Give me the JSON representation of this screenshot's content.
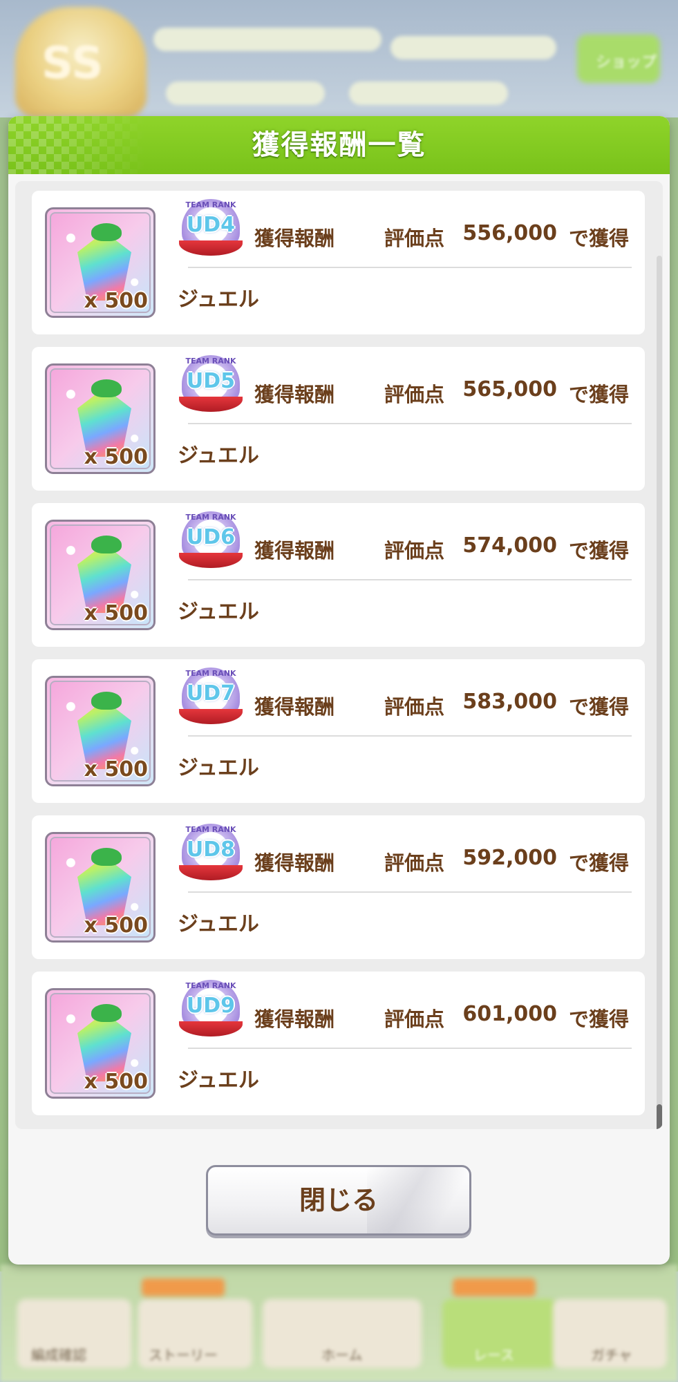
{
  "background": {
    "rank_emblem_text": "SS",
    "top_button_label": "ショップ",
    "nav": [
      "編成確認",
      "ストーリー",
      "ホーム",
      "レース",
      "ガチャ"
    ]
  },
  "dialog": {
    "title": "獲得報酬一覧",
    "close_label": "閉じる"
  },
  "rewards": [
    {
      "rank_team": "TEAM RANK",
      "rank": "UD4",
      "reward_label": "獲得報酬",
      "score_label": "評価点",
      "score": "556,000",
      "suffix": "で獲得",
      "quantity": "x 500",
      "item": "ジュエル"
    },
    {
      "rank_team": "TEAM RANK",
      "rank": "UD5",
      "reward_label": "獲得報酬",
      "score_label": "評価点",
      "score": "565,000",
      "suffix": "で獲得",
      "quantity": "x 500",
      "item": "ジュエル"
    },
    {
      "rank_team": "TEAM RANK",
      "rank": "UD6",
      "reward_label": "獲得報酬",
      "score_label": "評価点",
      "score": "574,000",
      "suffix": "で獲得",
      "quantity": "x 500",
      "item": "ジュエル"
    },
    {
      "rank_team": "TEAM RANK",
      "rank": "UD7",
      "reward_label": "獲得報酬",
      "score_label": "評価点",
      "score": "583,000",
      "suffix": "で獲得",
      "quantity": "x 500",
      "item": "ジュエル"
    },
    {
      "rank_team": "TEAM RANK",
      "rank": "UD8",
      "reward_label": "獲得報酬",
      "score_label": "評価点",
      "score": "592,000",
      "suffix": "で獲得",
      "quantity": "x 500",
      "item": "ジュエル"
    },
    {
      "rank_team": "TEAM RANK",
      "rank": "UD9",
      "reward_label": "獲得報酬",
      "score_label": "評価点",
      "score": "601,000",
      "suffix": "で獲得",
      "quantity": "x 500",
      "item": "ジュエル"
    }
  ],
  "colors": {
    "header_green": "#79c21a",
    "text_brown": "#6b3f1c",
    "rank_blue": "#5ec6ea",
    "ribbon_red": "#d42a32"
  },
  "icons": {
    "item": "jewel-icon",
    "rank": "team-rank-badge-icon"
  }
}
